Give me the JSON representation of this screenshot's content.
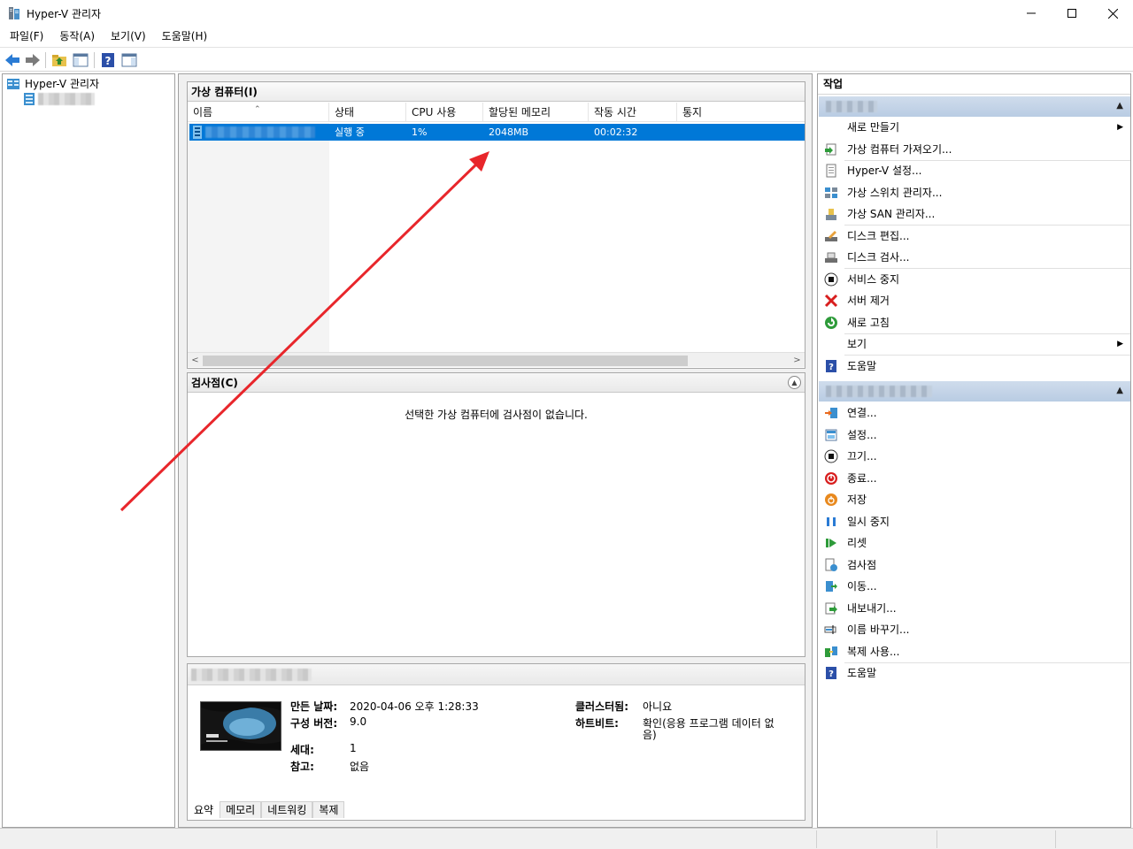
{
  "window": {
    "title": "Hyper-V 관리자",
    "minimize": "—",
    "maximize": "☐",
    "close": "✕"
  },
  "menu": [
    "파일(F)",
    "동작(A)",
    "보기(V)",
    "도움말(H)"
  ],
  "tree": {
    "root": "Hyper-V 관리자"
  },
  "vm_panel": {
    "title": "가상 컴퓨터(I)",
    "columns": [
      "이름",
      "상태",
      "CPU 사용",
      "할당된 메모리",
      "작동 시간",
      "통지"
    ],
    "rows": [
      {
        "state": "실행 중",
        "cpu": "1%",
        "memory": "2048MB",
        "uptime": "00:02:32"
      }
    ]
  },
  "checkpoint_panel": {
    "title": "검사점(C)",
    "message": "선택한 가상 컴퓨터에 검사점이 없습니다."
  },
  "details": {
    "created_label": "만든 날짜:",
    "created_value": "2020-04-06 오후 1:28:33",
    "config_label": "구성 버전:",
    "config_value": "9.0",
    "gen_label": "세대:",
    "gen_value": "1",
    "notes_label": "참고:",
    "notes_value": "없음",
    "cluster_label": "클러스터됨:",
    "cluster_value": "아니요",
    "heartbeat_label": "하트비트:",
    "heartbeat_value_1": "확인(응용 프로그램 데이터 없",
    "heartbeat_value_2": "음)",
    "tabs": [
      "요약",
      "메모리",
      "네트워킹",
      "복제"
    ]
  },
  "actions": {
    "title": "작업",
    "host_actions": [
      {
        "label": "새로 만들기",
        "icon": "blank",
        "submenu": true
      },
      {
        "label": "가상 컴퓨터 가져오기...",
        "icon": "import-icon"
      },
      {
        "label": "Hyper-V 설정...",
        "icon": "settings-doc-icon"
      },
      {
        "label": "가상 스위치 관리자...",
        "icon": "switch-icon"
      },
      {
        "label": "가상 SAN 관리자...",
        "icon": "san-icon"
      },
      {
        "label": "디스크 편집...",
        "icon": "disk-edit-icon"
      },
      {
        "label": "디스크 검사...",
        "icon": "disk-inspect-icon"
      },
      {
        "label": "서비스 중지",
        "icon": "stop-icon"
      },
      {
        "label": "서버 제거",
        "icon": "remove-icon"
      },
      {
        "label": "새로 고침",
        "icon": "refresh-icon"
      },
      {
        "label": "보기",
        "icon": "blank",
        "submenu": true
      },
      {
        "label": "도움말",
        "icon": "help-icon"
      }
    ],
    "vm_actions": [
      {
        "label": "연결...",
        "icon": "connect-icon"
      },
      {
        "label": "설정...",
        "icon": "settings-icon"
      },
      {
        "label": "끄기...",
        "icon": "turn-off-icon"
      },
      {
        "label": "종료...",
        "icon": "shutdown-icon"
      },
      {
        "label": "저장",
        "icon": "save-icon"
      },
      {
        "label": "일시 중지",
        "icon": "pause-icon"
      },
      {
        "label": "리셋",
        "icon": "reset-icon"
      },
      {
        "label": "검사점",
        "icon": "checkpoint-icon"
      },
      {
        "label": "이동...",
        "icon": "move-icon"
      },
      {
        "label": "내보내기...",
        "icon": "export-icon"
      },
      {
        "label": "이름 바꾸기...",
        "icon": "rename-icon"
      },
      {
        "label": "복제 사용...",
        "icon": "replication-icon"
      },
      {
        "label": "도움말",
        "icon": "help-icon"
      }
    ]
  },
  "colors": {
    "selection": "#0078d7",
    "section_header": "#c6d6ea",
    "annotation_arrow": "#e8262b"
  }
}
